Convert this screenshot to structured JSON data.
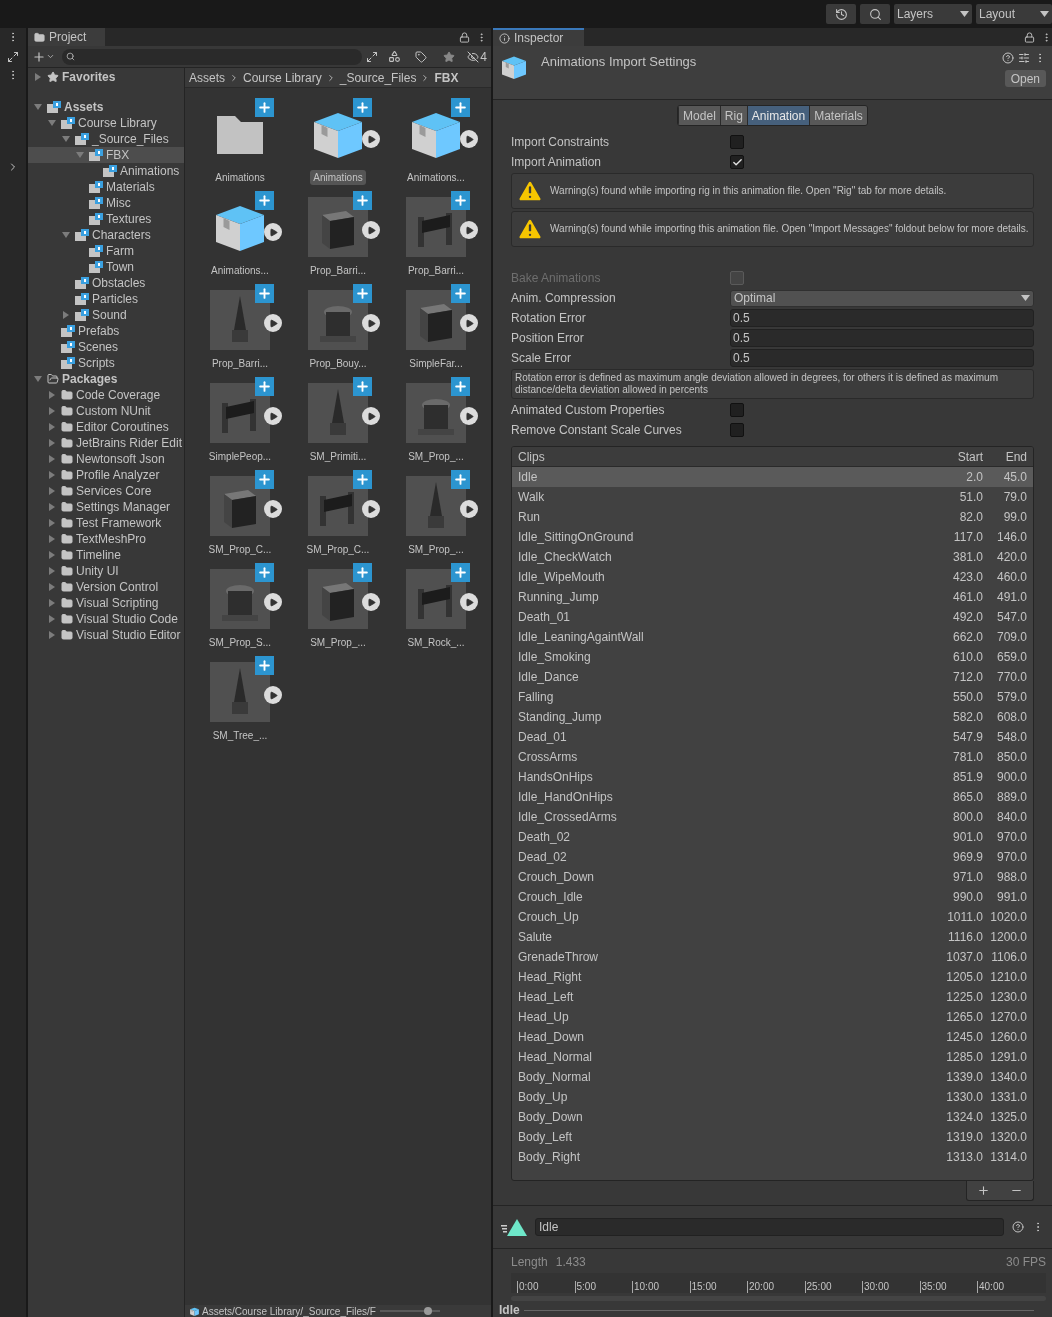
{
  "toolbar": {
    "layers": "Layers",
    "layout": "Layout"
  },
  "project": {
    "tab": "Project",
    "hidden_count": "4",
    "tree": [
      {
        "name": "Favorites",
        "kind": "favorites",
        "expanded": false,
        "selected": false
      },
      {
        "name": "Assets",
        "kind": "asset-root",
        "expanded": true,
        "selected": false,
        "children": [
          {
            "name": "Course Library",
            "kind": "asset-folder",
            "expanded": true,
            "selected": false,
            "children": [
              {
                "name": "_Source_Files",
                "kind": "asset-folder",
                "expanded": true,
                "selected": false,
                "children": [
                  {
                    "name": "FBX",
                    "kind": "asset-folder",
                    "expanded": true,
                    "selected": true,
                    "children": [
                      {
                        "name": "Animations",
                        "kind": "asset-folder",
                        "selected": false
                      }
                    ]
                  },
                  {
                    "name": "Materials",
                    "kind": "asset-folder",
                    "selected": false
                  },
                  {
                    "name": "Misc",
                    "kind": "asset-folder",
                    "selected": false
                  },
                  {
                    "name": "Textures",
                    "kind": "asset-folder",
                    "selected": false
                  }
                ]
              },
              {
                "name": "Characters",
                "kind": "asset-folder",
                "expanded": true,
                "selected": false,
                "children": [
                  {
                    "name": "Farm",
                    "kind": "asset-folder",
                    "selected": false
                  },
                  {
                    "name": "Town",
                    "kind": "asset-folder",
                    "selected": false
                  }
                ]
              },
              {
                "name": "Obstacles",
                "kind": "asset-folder",
                "selected": false
              },
              {
                "name": "Particles",
                "kind": "asset-folder",
                "selected": false
              },
              {
                "name": "Sound",
                "kind": "asset-folder",
                "expanded": false,
                "selected": false
              }
            ]
          },
          {
            "name": "Prefabs",
            "kind": "asset-folder",
            "selected": false
          },
          {
            "name": "Scenes",
            "kind": "asset-folder",
            "selected": false
          },
          {
            "name": "Scripts",
            "kind": "asset-folder",
            "selected": false
          }
        ]
      },
      {
        "name": "Packages",
        "kind": "packages-root",
        "expanded": true,
        "selected": false,
        "children": [
          {
            "name": "Code Coverage",
            "kind": "package",
            "expanded": false,
            "selected": false
          },
          {
            "name": "Custom NUnit",
            "kind": "package",
            "expanded": false,
            "selected": false
          },
          {
            "name": "Editor Coroutines",
            "kind": "package",
            "expanded": false,
            "selected": false
          },
          {
            "name": "JetBrains Rider Edit",
            "kind": "package",
            "expanded": false,
            "selected": false
          },
          {
            "name": "Newtonsoft Json",
            "kind": "package",
            "expanded": false,
            "selected": false
          },
          {
            "name": "Profile Analyzer",
            "kind": "package",
            "expanded": false,
            "selected": false
          },
          {
            "name": "Services Core",
            "kind": "package",
            "expanded": false,
            "selected": false
          },
          {
            "name": "Settings Manager",
            "kind": "package",
            "expanded": false,
            "selected": false
          },
          {
            "name": "Test Framework",
            "kind": "package",
            "expanded": false,
            "selected": false
          },
          {
            "name": "TextMeshPro",
            "kind": "package",
            "expanded": false,
            "selected": false
          },
          {
            "name": "Timeline",
            "kind": "package",
            "expanded": false,
            "selected": false
          },
          {
            "name": "Unity UI",
            "kind": "package",
            "expanded": false,
            "selected": false
          },
          {
            "name": "Version Control",
            "kind": "package",
            "expanded": false,
            "selected": false
          },
          {
            "name": "Visual Scripting",
            "kind": "package",
            "expanded": false,
            "selected": false
          },
          {
            "name": "Visual Studio Code",
            "kind": "package",
            "expanded": false,
            "selected": false
          },
          {
            "name": "Visual Studio Editor",
            "kind": "package",
            "expanded": false,
            "selected": false
          }
        ]
      }
    ],
    "breadcrumb": [
      "Assets",
      "Course Library",
      "_Source_Files",
      "FBX"
    ],
    "assets": [
      {
        "name": "Animations",
        "kind": "folder",
        "selected": false
      },
      {
        "name": "Animations",
        "kind": "animation",
        "selected": true
      },
      {
        "name": "Animations...",
        "kind": "animation",
        "selected": false
      },
      {
        "name": "Animations...",
        "kind": "animation",
        "selected": false
      },
      {
        "name": "Prop_Barri...",
        "kind": "mesh",
        "selected": false
      },
      {
        "name": "Prop_Barri...",
        "kind": "mesh",
        "selected": false
      },
      {
        "name": "Prop_Barri...",
        "kind": "mesh",
        "selected": false
      },
      {
        "name": "Prop_Bouy...",
        "kind": "mesh",
        "selected": false
      },
      {
        "name": "SimpleFar...",
        "kind": "mesh",
        "selected": false
      },
      {
        "name": "SimplePeop...",
        "kind": "mesh",
        "selected": false
      },
      {
        "name": "SM_Primiti...",
        "kind": "mesh",
        "selected": false
      },
      {
        "name": "SM_Prop_...",
        "kind": "mesh",
        "selected": false
      },
      {
        "name": "SM_Prop_C...",
        "kind": "mesh",
        "selected": false
      },
      {
        "name": "SM_Prop_C...",
        "kind": "mesh",
        "selected": false
      },
      {
        "name": "SM_Prop_...",
        "kind": "mesh",
        "selected": false
      },
      {
        "name": "SM_Prop_S...",
        "kind": "mesh",
        "selected": false
      },
      {
        "name": "SM_Prop_...",
        "kind": "mesh",
        "selected": false
      },
      {
        "name": "SM_Rock_...",
        "kind": "mesh",
        "selected": false
      },
      {
        "name": "SM_Tree_...",
        "kind": "mesh",
        "selected": false
      }
    ],
    "path": "Assets/Course Library/_Source_Files/F",
    "zoom": {
      "level": 0.8
    }
  },
  "inspector": {
    "tab": "Inspector",
    "title": "Animations Import Settings",
    "open_button": "Open",
    "tabs": [
      {
        "label": "Model",
        "selected": false
      },
      {
        "label": "Rig",
        "selected": false
      },
      {
        "label": "Animation",
        "selected": true
      },
      {
        "label": "Materials",
        "selected": false
      }
    ],
    "fields": [
      {
        "kind": "checkbox",
        "label": "Import Constraints",
        "checked": false,
        "disabled": false
      },
      {
        "kind": "checkbox",
        "label": "Import Animation",
        "checked": true,
        "disabled": false
      },
      {
        "kind": "warning",
        "text": "Warning(s) found while importing rig in this animation file. Open \"Rig\" tab for more details."
      },
      {
        "kind": "warning",
        "text": "Warning(s) found while importing this animation file. Open \"Import Messages\" foldout below for more details."
      },
      {
        "kind": "checkbox",
        "label": "Bake Animations",
        "checked": false,
        "disabled": true
      },
      {
        "kind": "dropdown",
        "label": "Anim. Compression",
        "value": "Optimal"
      },
      {
        "kind": "number",
        "label": "Rotation Error",
        "value": "0.5"
      },
      {
        "kind": "number",
        "label": "Position Error",
        "value": "0.5"
      },
      {
        "kind": "number",
        "label": "Scale Error",
        "value": "0.5"
      },
      {
        "kind": "help",
        "text": "Rotation error is defined as maximum angle deviation allowed in degrees, for others it is defined as maximum distance/delta deviation allowed in percents"
      },
      {
        "kind": "checkbox",
        "label": "Animated Custom Properties",
        "checked": false,
        "disabled": false
      },
      {
        "kind": "checkbox",
        "label": "Remove Constant Scale Curves",
        "checked": false,
        "disabled": false
      }
    ],
    "clips": {
      "columns": [
        "Clips",
        "Start",
        "End"
      ],
      "rows": [
        {
          "name": "Idle",
          "start": "2.0",
          "end": "45.0",
          "selected": true
        },
        {
          "name": "Walk",
          "start": "51.0",
          "end": "79.0",
          "selected": false
        },
        {
          "name": "Run",
          "start": "82.0",
          "end": "99.0",
          "selected": false
        },
        {
          "name": "Idle_SittingOnGround",
          "start": "117.0",
          "end": "146.0",
          "selected": false
        },
        {
          "name": "Idle_CheckWatch",
          "start": "381.0",
          "end": "420.0",
          "selected": false
        },
        {
          "name": "Idle_WipeMouth",
          "start": "423.0",
          "end": "460.0",
          "selected": false
        },
        {
          "name": "Running_Jump",
          "start": "461.0",
          "end": "491.0",
          "selected": false
        },
        {
          "name": "Death_01",
          "start": "492.0",
          "end": "547.0",
          "selected": false
        },
        {
          "name": "Idle_LeaningAgaintWall",
          "start": "662.0",
          "end": "709.0",
          "selected": false
        },
        {
          "name": "Idle_Smoking",
          "start": "610.0",
          "end": "659.0",
          "selected": false
        },
        {
          "name": "Idle_Dance",
          "start": "712.0",
          "end": "770.0",
          "selected": false
        },
        {
          "name": "Falling",
          "start": "550.0",
          "end": "579.0",
          "selected": false
        },
        {
          "name": "Standing_Jump",
          "start": "582.0",
          "end": "608.0",
          "selected": false
        },
        {
          "name": "Dead_01",
          "start": "547.9",
          "end": "548.0",
          "selected": false
        },
        {
          "name": "CrossArms",
          "start": "781.0",
          "end": "850.0",
          "selected": false
        },
        {
          "name": "HandsOnHips",
          "start": "851.9",
          "end": "900.0",
          "selected": false
        },
        {
          "name": "Idle_HandOnHips",
          "start": "865.0",
          "end": "889.0",
          "selected": false
        },
        {
          "name": "Idle_CrossedArms",
          "start": "800.0",
          "end": "840.0",
          "selected": false
        },
        {
          "name": "Death_02",
          "start": "901.0",
          "end": "970.0",
          "selected": false
        },
        {
          "name": "Dead_02",
          "start": "969.9",
          "end": "970.0",
          "selected": false
        },
        {
          "name": "Crouch_Down",
          "start": "971.0",
          "end": "988.0",
          "selected": false
        },
        {
          "name": "Crouch_Idle",
          "start": "990.0",
          "end": "991.0",
          "selected": false
        },
        {
          "name": "Crouch_Up",
          "start": "1011.0",
          "end": "1020.0",
          "selected": false
        },
        {
          "name": "Salute",
          "start": "1116.0",
          "end": "1200.0",
          "selected": false
        },
        {
          "name": "GrenadeThrow",
          "start": "1037.0",
          "end": "1106.0",
          "selected": false
        },
        {
          "name": "Head_Right",
          "start": "1205.0",
          "end": "1210.0",
          "selected": false
        },
        {
          "name": "Head_Left",
          "start": "1225.0",
          "end": "1230.0",
          "selected": false
        },
        {
          "name": "Head_Up",
          "start": "1265.0",
          "end": "1270.0",
          "selected": false
        },
        {
          "name": "Head_Down",
          "start": "1245.0",
          "end": "1260.0",
          "selected": false
        },
        {
          "name": "Head_Normal",
          "start": "1285.0",
          "end": "1291.0",
          "selected": false
        },
        {
          "name": "Body_Normal",
          "start": "1339.0",
          "end": "1340.0",
          "selected": false
        },
        {
          "name": "Body_Up",
          "start": "1330.0",
          "end": "1331.0",
          "selected": false
        },
        {
          "name": "Body_Down",
          "start": "1324.0",
          "end": "1325.0",
          "selected": false
        },
        {
          "name": "Body_Left",
          "start": "1319.0",
          "end": "1320.0",
          "selected": false
        },
        {
          "name": "Body_Right",
          "start": "1313.0",
          "end": "1314.0",
          "selected": false
        }
      ]
    },
    "clip_name": "Idle",
    "preview": {
      "length_label": "Length",
      "length": "1.433",
      "fps": "30 FPS",
      "ticks": [
        "0:00",
        "5:00",
        "10:00",
        "15:00",
        "20:00",
        "25:00",
        "30:00",
        "35:00",
        "40:00"
      ],
      "footer": "Idle"
    }
  }
}
